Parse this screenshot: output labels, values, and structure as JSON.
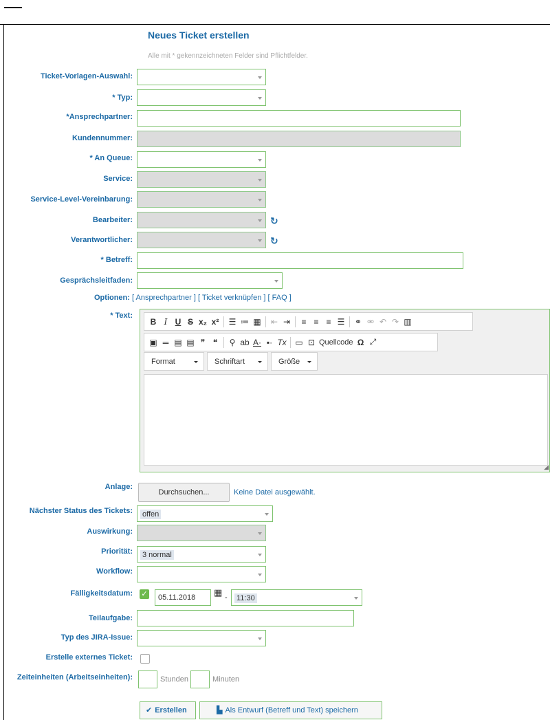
{
  "header": {
    "title": "Neues Ticket erstellen",
    "hint": "Alle mit * gekennzeichneten Felder sind Pflichtfelder."
  },
  "fields": {
    "template": {
      "label": "Ticket-Vorlagen-Auswahl:"
    },
    "type": {
      "label": "Typ:"
    },
    "contact": {
      "label": "Ansprechpartner:"
    },
    "customer_no": {
      "label": "Kundennummer:"
    },
    "queue": {
      "label": "An Queue:"
    },
    "service": {
      "label": "Service:"
    },
    "sla": {
      "label": "Service-Level-Vereinbarung:"
    },
    "owner": {
      "label": "Bearbeiter:"
    },
    "responsible": {
      "label": "Verantwortlicher:"
    },
    "subject": {
      "label": "Betreff:"
    },
    "guide": {
      "label": "Gesprächsleitfaden:"
    },
    "text": {
      "label": "Text:"
    },
    "attachment": {
      "label": "Anlage:",
      "button": "Durchsuchen...",
      "status": "Keine Datei ausgewählt."
    },
    "next_state": {
      "label": "Nächster Status des Tickets:",
      "value": "offen"
    },
    "impact": {
      "label": "Auswirkung:"
    },
    "priority": {
      "label": "Priorität:",
      "value": "3 normal"
    },
    "workflow": {
      "label": "Workflow:"
    },
    "due_date": {
      "label": "Fälligkeitsdatum:",
      "date": "05.11.2018",
      "sep": "-",
      "time": "11:30"
    },
    "subtask": {
      "label": "Teilaufgabe:"
    },
    "jira_type": {
      "label": "Typ des JIRA-Issue:"
    },
    "external": {
      "label": "Erstelle externes Ticket:"
    },
    "time_units": {
      "label": "Zeiteinheiten (Arbeitseinheiten):",
      "hours": "Stunden",
      "minutes": "Minuten"
    }
  },
  "required_mark": "*",
  "options": {
    "label": "Optionen:",
    "links": [
      "[ Ansprechpartner ]",
      "[ Ticket verknüpfen ]",
      "[ FAQ ]"
    ]
  },
  "editor": {
    "combos": [
      "Format",
      "Schriftart",
      "Größe"
    ],
    "source_label": "Quellcode"
  },
  "actions": {
    "create": "Erstellen",
    "draft": "Als Entwurf (Betreff und Text) speichern"
  }
}
